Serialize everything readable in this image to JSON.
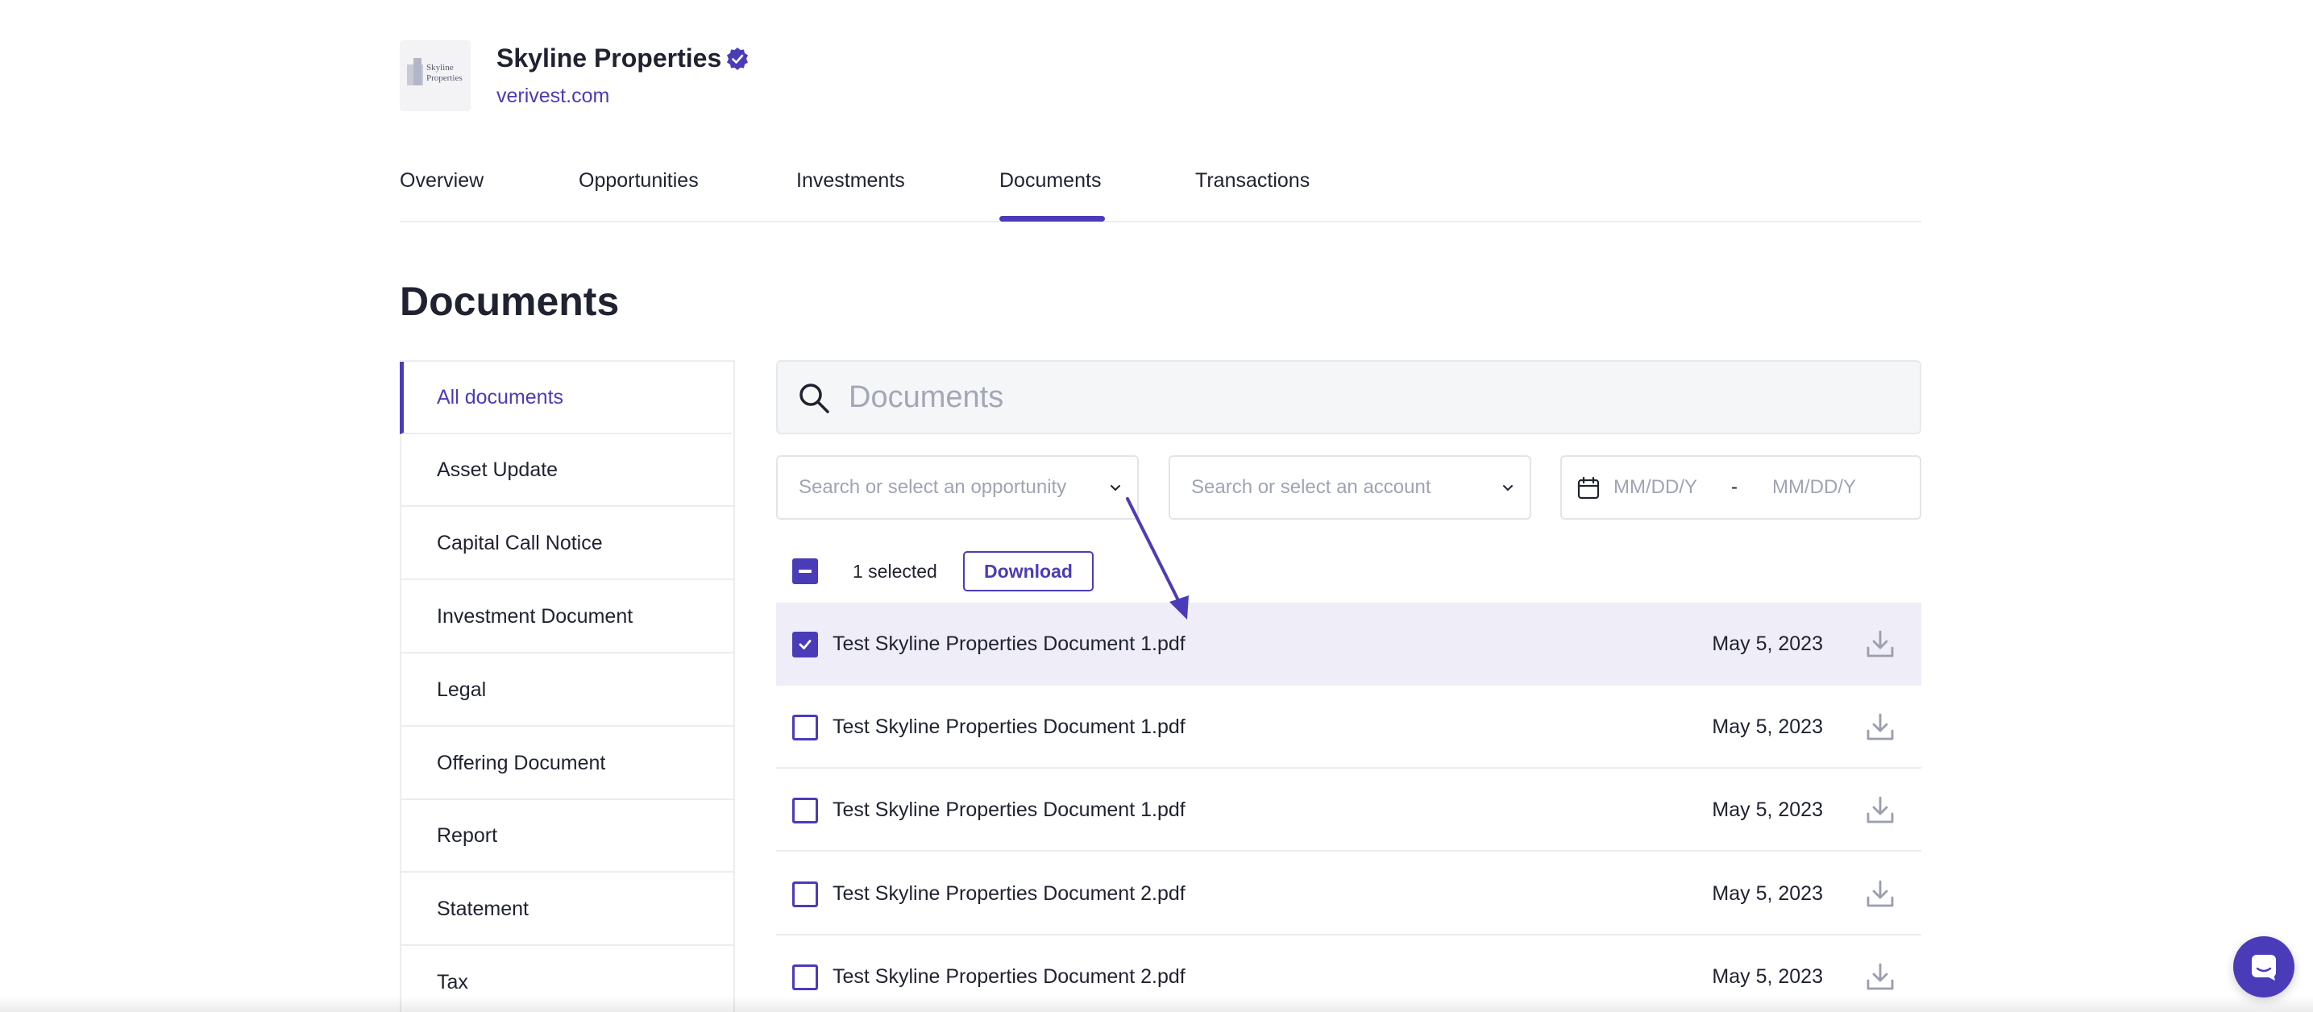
{
  "org": {
    "logo_text": "Skyline Properties",
    "name": "Skyline Properties",
    "link": "verivest.com"
  },
  "tabs": [
    {
      "label": "Overview",
      "active": false
    },
    {
      "label": "Opportunities",
      "active": false
    },
    {
      "label": "Investments",
      "active": false
    },
    {
      "label": "Documents",
      "active": true
    },
    {
      "label": "Transactions",
      "active": false
    }
  ],
  "page_title": "Documents",
  "sidebar": {
    "items": [
      {
        "label": "All documents",
        "active": true
      },
      {
        "label": "Asset Update",
        "active": false
      },
      {
        "label": "Capital Call Notice",
        "active": false
      },
      {
        "label": "Investment Document",
        "active": false
      },
      {
        "label": "Legal",
        "active": false
      },
      {
        "label": "Offering Document",
        "active": false
      },
      {
        "label": "Report",
        "active": false
      },
      {
        "label": "Statement",
        "active": false
      },
      {
        "label": "Tax",
        "active": false
      }
    ]
  },
  "search": {
    "placeholder": "Documents"
  },
  "filters": {
    "opportunity_placeholder": "Search or select an opportunity",
    "account_placeholder": "Search or select an account",
    "date_from_placeholder": "MM/DD/Y",
    "date_separator": "-",
    "date_to_placeholder": "MM/DD/Y"
  },
  "selection": {
    "count_label": "1 selected",
    "download_label": "Download"
  },
  "documents": [
    {
      "name": "Test Skyline Properties Document 1.pdf",
      "date": "May 5, 2023",
      "checked": true
    },
    {
      "name": "Test Skyline Properties Document 1.pdf",
      "date": "May 5, 2023",
      "checked": false
    },
    {
      "name": "Test Skyline Properties Document 1.pdf",
      "date": "May 5, 2023",
      "checked": false
    },
    {
      "name": "Test Skyline Properties Document 2.pdf",
      "date": "May 5, 2023",
      "checked": false
    },
    {
      "name": "Test Skyline Properties Document 2.pdf",
      "date": "May 5, 2023",
      "checked": false
    }
  ],
  "colors": {
    "accent": "#4a3cb8",
    "selected_row": "#efedf7",
    "border": "#ececf1",
    "placeholder": "#9fa3b3"
  },
  "icons": {
    "verified": "verified-badge-icon",
    "search": "search-icon",
    "chevron": "chevron-down-icon",
    "calendar": "calendar-icon",
    "download": "download-icon",
    "chat": "chat-icon"
  }
}
